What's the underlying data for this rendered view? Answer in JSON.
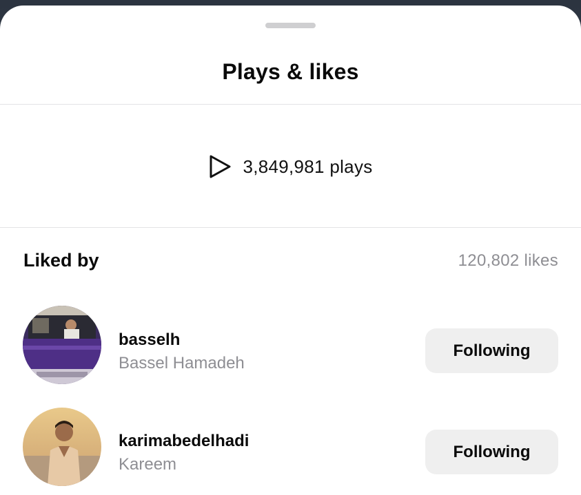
{
  "sheet": {
    "title": "Plays & likes"
  },
  "plays": {
    "icon": "play-icon",
    "text": "3,849,981 plays"
  },
  "liked_by": {
    "heading": "Liked by",
    "count_text": "120,802 likes"
  },
  "users": [
    {
      "username": "basselh",
      "full_name": "Bassel Hamadeh",
      "button_label": "Following",
      "avatar": "user-avatar-photo"
    },
    {
      "username": "karimabedelhadi",
      "full_name": "Kareem",
      "button_label": "Following",
      "avatar": "user-avatar-photo"
    }
  ],
  "colors": {
    "primary_text": "#0a0a0a",
    "secondary_text": "#8e8e93",
    "button_bg": "#efefef",
    "divider": "#e3e3e5"
  }
}
